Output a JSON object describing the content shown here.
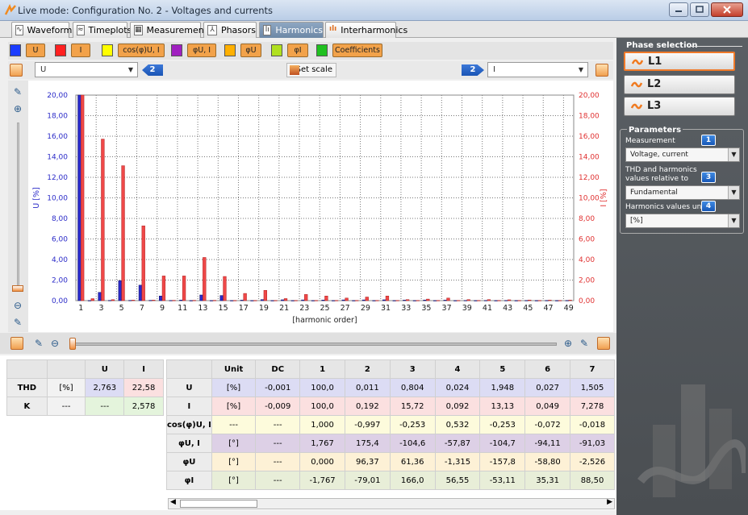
{
  "window": {
    "title": "Live mode: Configuration No. 2 - Voltages and currents"
  },
  "tabs": [
    {
      "label": "Waveforms",
      "icon": "waveform-icon",
      "active": false
    },
    {
      "label": "Timeplots",
      "icon": "timeplot-icon",
      "active": false
    },
    {
      "label": "Measurements",
      "icon": "table-icon",
      "active": false
    },
    {
      "label": "Phasors",
      "icon": "phasor-icon",
      "active": false
    },
    {
      "label": "Harmonics",
      "icon": "harmonics-icon",
      "active": true
    },
    {
      "label": "Interharmonics",
      "icon": "interharmonics-icon",
      "active": false
    }
  ],
  "series_buttons": [
    {
      "label": "U",
      "color": "#1a3cff"
    },
    {
      "label": "I",
      "color": "#ff2020"
    },
    {
      "label": "cos(φ)U, I",
      "color": "#ffff00"
    },
    {
      "label": "φU, I",
      "color": "#a020c0"
    },
    {
      "label": "φU",
      "color": "#ffb000"
    },
    {
      "label": "φI",
      "color": "#b0e020"
    },
    {
      "label": "Coefficients",
      "color": "#20c020"
    }
  ],
  "controls": {
    "left_dropdown": "U",
    "left_badge": "2",
    "set_scale": "Set scale",
    "right_badge": "2",
    "right_dropdown": "I"
  },
  "chart_data": {
    "type": "bar",
    "xlabel": "[harmonic order]",
    "ylabel_left": "U [%]",
    "ylabel_right": "I [%]",
    "ylim": [
      0,
      20
    ],
    "y_ticks_left": [
      "0,00",
      "2,00",
      "4,00",
      "6,00",
      "8,00",
      "10,00",
      "12,00",
      "14,00",
      "16,00",
      "18,00",
      "20,00"
    ],
    "y_ticks_right": [
      "0,00",
      "2,00",
      "4,00",
      "6,00",
      "8,00",
      "10,00",
      "12,00",
      "14,00",
      "16,00",
      "18,00",
      "20,00"
    ],
    "x_tick_labels": [
      "1",
      "3",
      "5",
      "7",
      "9",
      "11",
      "13",
      "15",
      "17",
      "19",
      "21",
      "23",
      "25",
      "27",
      "29",
      "31",
      "33",
      "35",
      "37",
      "39",
      "41",
      "43",
      "45",
      "47",
      "49"
    ],
    "series": [
      {
        "name": "U",
        "color": "#2a2ac8",
        "values": [
          100,
          0.011,
          0.804,
          0.024,
          1.948,
          0.027,
          1.505,
          0.03,
          0.45,
          0.02,
          0.06,
          0.01,
          0.55,
          0.01,
          0.5,
          0.01,
          0.05,
          0.01,
          0.1,
          0.01,
          0.08,
          0.01,
          0.07,
          0.01,
          0.06,
          0.01,
          0.07,
          0.01,
          0.07,
          0.01,
          0.08,
          0.01,
          0.05,
          0.01,
          0.06,
          0.01,
          0.05,
          0.01,
          0.02,
          0.01,
          0.02,
          0.01,
          0.02,
          0.01,
          0.02,
          0.01,
          0.02,
          0.01,
          0.02
        ]
      },
      {
        "name": "I",
        "color": "#ef4848",
        "values": [
          100,
          0.192,
          15.72,
          0.092,
          13.13,
          0.049,
          7.278,
          0.05,
          2.4,
          0.03,
          2.4,
          0.03,
          4.2,
          0.03,
          2.35,
          0.02,
          0.7,
          0.02,
          1.0,
          0.02,
          0.2,
          0.02,
          0.6,
          0.02,
          0.45,
          0.02,
          0.25,
          0.02,
          0.35,
          0.02,
          0.45,
          0.02,
          0.1,
          0.02,
          0.15,
          0.02,
          0.25,
          0.02,
          0.1,
          0.02,
          0.1,
          0.02,
          0.08,
          0.02,
          0.06,
          0.02,
          0.05,
          0.02,
          0.05
        ]
      }
    ]
  },
  "left_table": {
    "headers": [
      "",
      "",
      "U",
      "I"
    ],
    "rows": [
      {
        "label": "THD",
        "unit": "[%]",
        "u": "2,763",
        "i": "22,58"
      },
      {
        "label": "K",
        "unit": "---",
        "u": "---",
        "i": "2,578"
      }
    ]
  },
  "right_table": {
    "headers": [
      "",
      "Unit",
      "DC",
      "1",
      "2",
      "3",
      "4",
      "5",
      "6",
      "7"
    ],
    "rows": [
      {
        "label": "U",
        "color": "#dcdcf4",
        "cells": [
          "[%]",
          "-0,001",
          "100,0",
          "0,011",
          "0,804",
          "0,024",
          "1,948",
          "0,027",
          "1,505"
        ]
      },
      {
        "label": "I",
        "color": "#fbe0e0",
        "cells": [
          "[%]",
          "-0,009",
          "100,0",
          "0,192",
          "15,72",
          "0,092",
          "13,13",
          "0,049",
          "7,278"
        ]
      },
      {
        "label": "cos(φ)U, I",
        "color": "#fdfbdc",
        "cells": [
          "---",
          "---",
          "1,000",
          "-0,997",
          "-0,253",
          "0,532",
          "-0,253",
          "-0,072",
          "-0,018"
        ]
      },
      {
        "label": "φU, I",
        "color": "#ddd0e6",
        "cells": [
          "[°]",
          "---",
          "1,767",
          "175,4",
          "-104,6",
          "-57,87",
          "-104,7",
          "-94,11",
          "-91,03"
        ]
      },
      {
        "label": "φU",
        "color": "#fdf1d6",
        "cells": [
          "[°]",
          "---",
          "0,000",
          "96,37",
          "61,36",
          "-1,315",
          "-157,8",
          "-58,80",
          "-2,526"
        ]
      },
      {
        "label": "φI",
        "color": "#e8eed8",
        "cells": [
          "[°]",
          "---",
          "-1,767",
          "-79,01",
          "166,0",
          "56,55",
          "-53,11",
          "35,31",
          "88,50"
        ]
      }
    ]
  },
  "sidebar": {
    "phase_title": "Phase selection",
    "phases": [
      {
        "label": "L1",
        "selected": true
      },
      {
        "label": "L2",
        "selected": false
      },
      {
        "label": "L3",
        "selected": false
      }
    ],
    "params_title": "Parameters",
    "measurement_label": "Measurement",
    "measurement_badge": "1",
    "measurement_value": "Voltage, current",
    "relative_label": "THD and harmonics values relative to",
    "relative_badge": "3",
    "relative_value": "Fundamental",
    "unit_label": "Harmonics values unit",
    "unit_badge": "4",
    "unit_value": "[%]"
  }
}
